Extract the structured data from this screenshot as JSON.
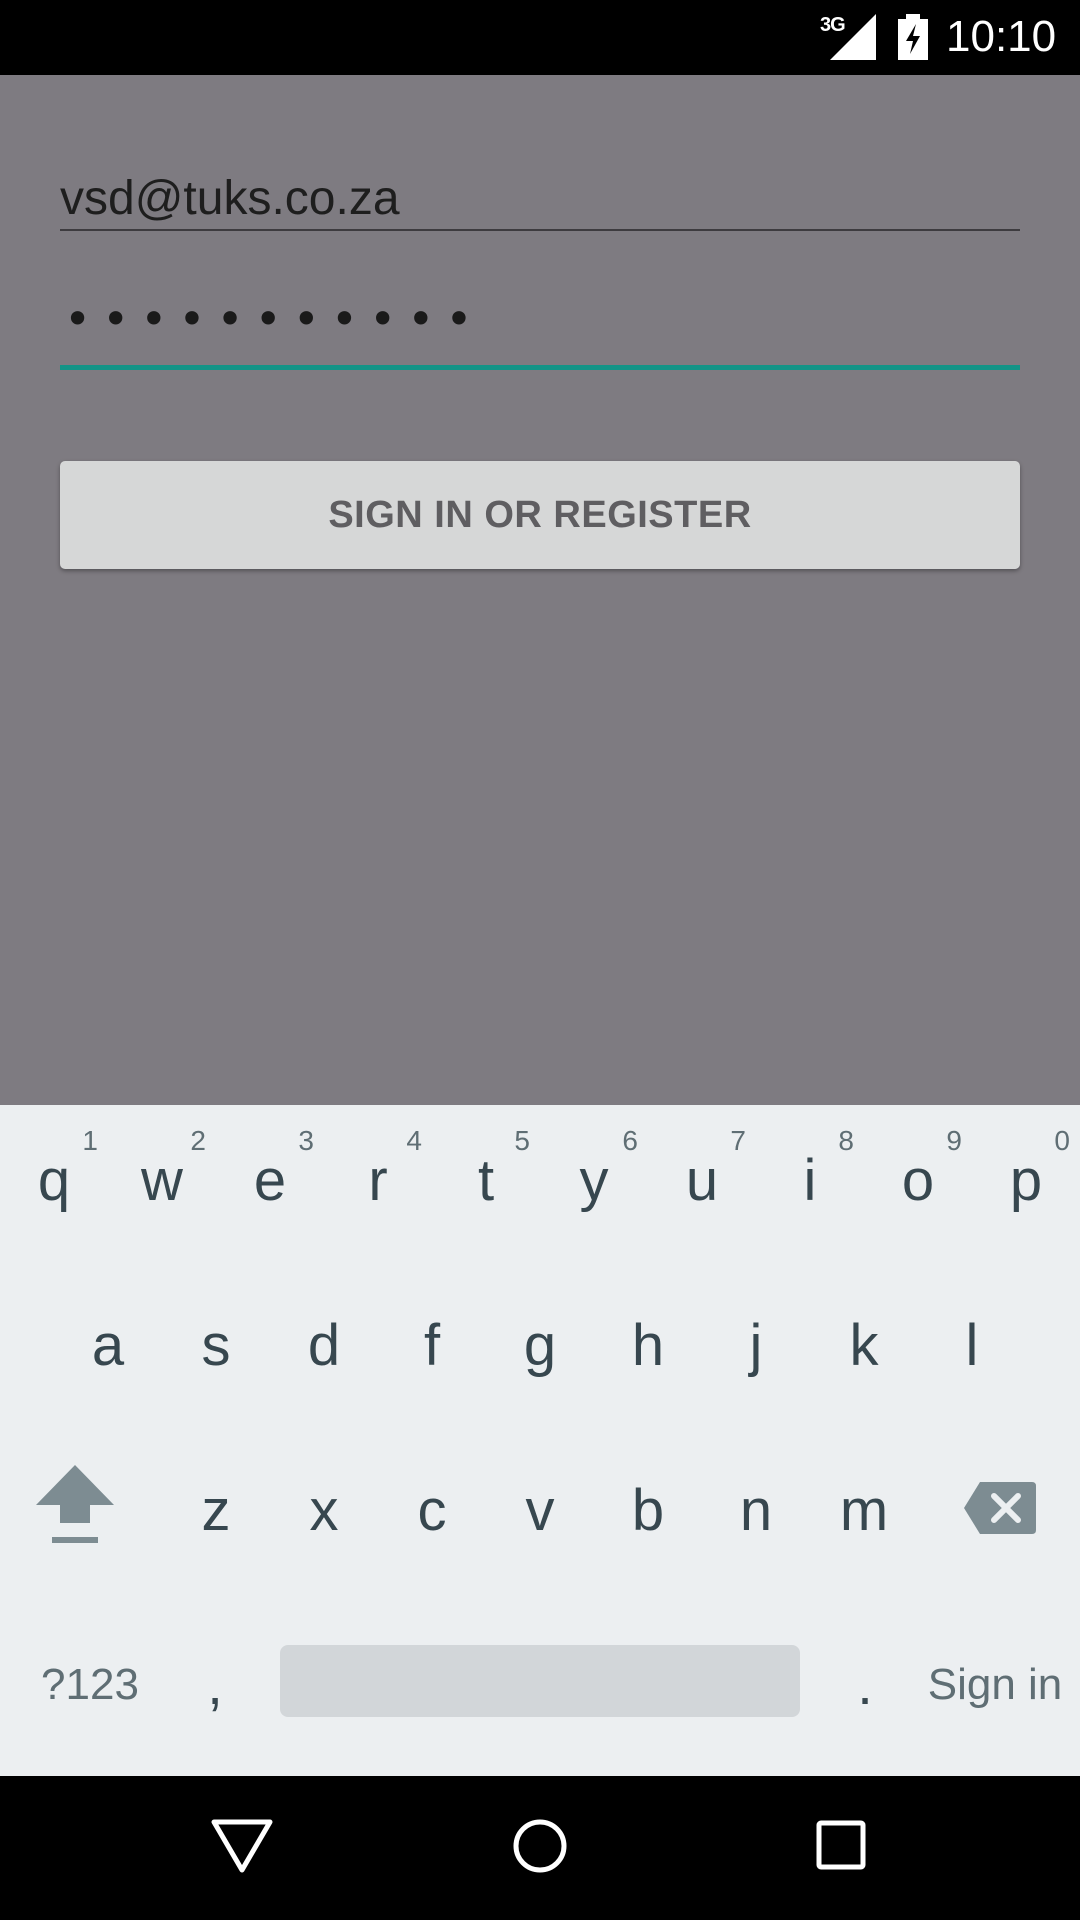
{
  "status_bar": {
    "network": "3G",
    "time": "10:10",
    "icons": [
      "signal-icon",
      "battery-charging-icon"
    ]
  },
  "form": {
    "email_value": "vsd@tuks.co.za",
    "password_mask": "•••••••••••",
    "button_label": "SIGN IN OR REGISTER",
    "accent_color": "#139487"
  },
  "keyboard": {
    "row1": [
      {
        "char": "q",
        "hint": "1"
      },
      {
        "char": "w",
        "hint": "2"
      },
      {
        "char": "e",
        "hint": "3"
      },
      {
        "char": "r",
        "hint": "4"
      },
      {
        "char": "t",
        "hint": "5"
      },
      {
        "char": "y",
        "hint": "6"
      },
      {
        "char": "u",
        "hint": "7"
      },
      {
        "char": "i",
        "hint": "8"
      },
      {
        "char": "o",
        "hint": "9"
      },
      {
        "char": "p",
        "hint": "0"
      }
    ],
    "row2": [
      "a",
      "s",
      "d",
      "f",
      "g",
      "h",
      "j",
      "k",
      "l"
    ],
    "row3": [
      "z",
      "x",
      "c",
      "v",
      "b",
      "n",
      "m"
    ],
    "symbols_label": "?123",
    "comma": ",",
    "period": ".",
    "action_label": "Sign in"
  }
}
